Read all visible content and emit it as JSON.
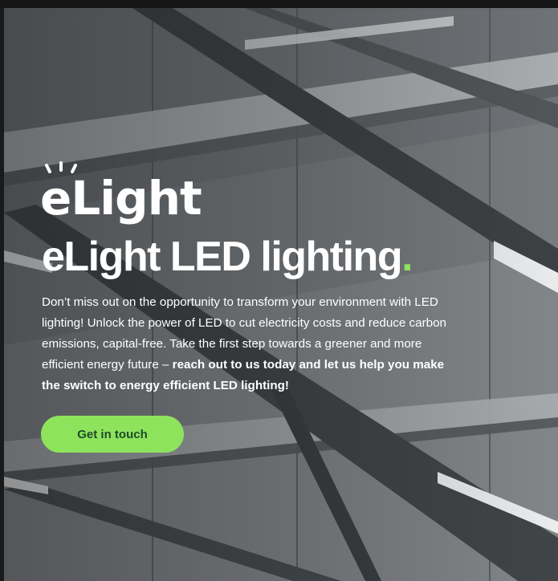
{
  "brand": {
    "logo_text": "eLight",
    "accent_color": "#8ee35d",
    "logo_icon": "light-rays-icon"
  },
  "hero": {
    "headline": "eLight LED lighting",
    "headline_dot": ".",
    "body_regular": "Don’t miss out on the opportunity to transform your environment with LED lighting! Unlock the power of LED to cut electricity costs and reduce carbon emissions, capital-free. Take the first step towards a greener and more efficient energy future – ",
    "body_bold": "reach out to us today and let us help you make the switch to energy efficient LED lighting!",
    "cta_label": "Get in touch",
    "background_image": "warehouse-ceiling-led-lights"
  }
}
